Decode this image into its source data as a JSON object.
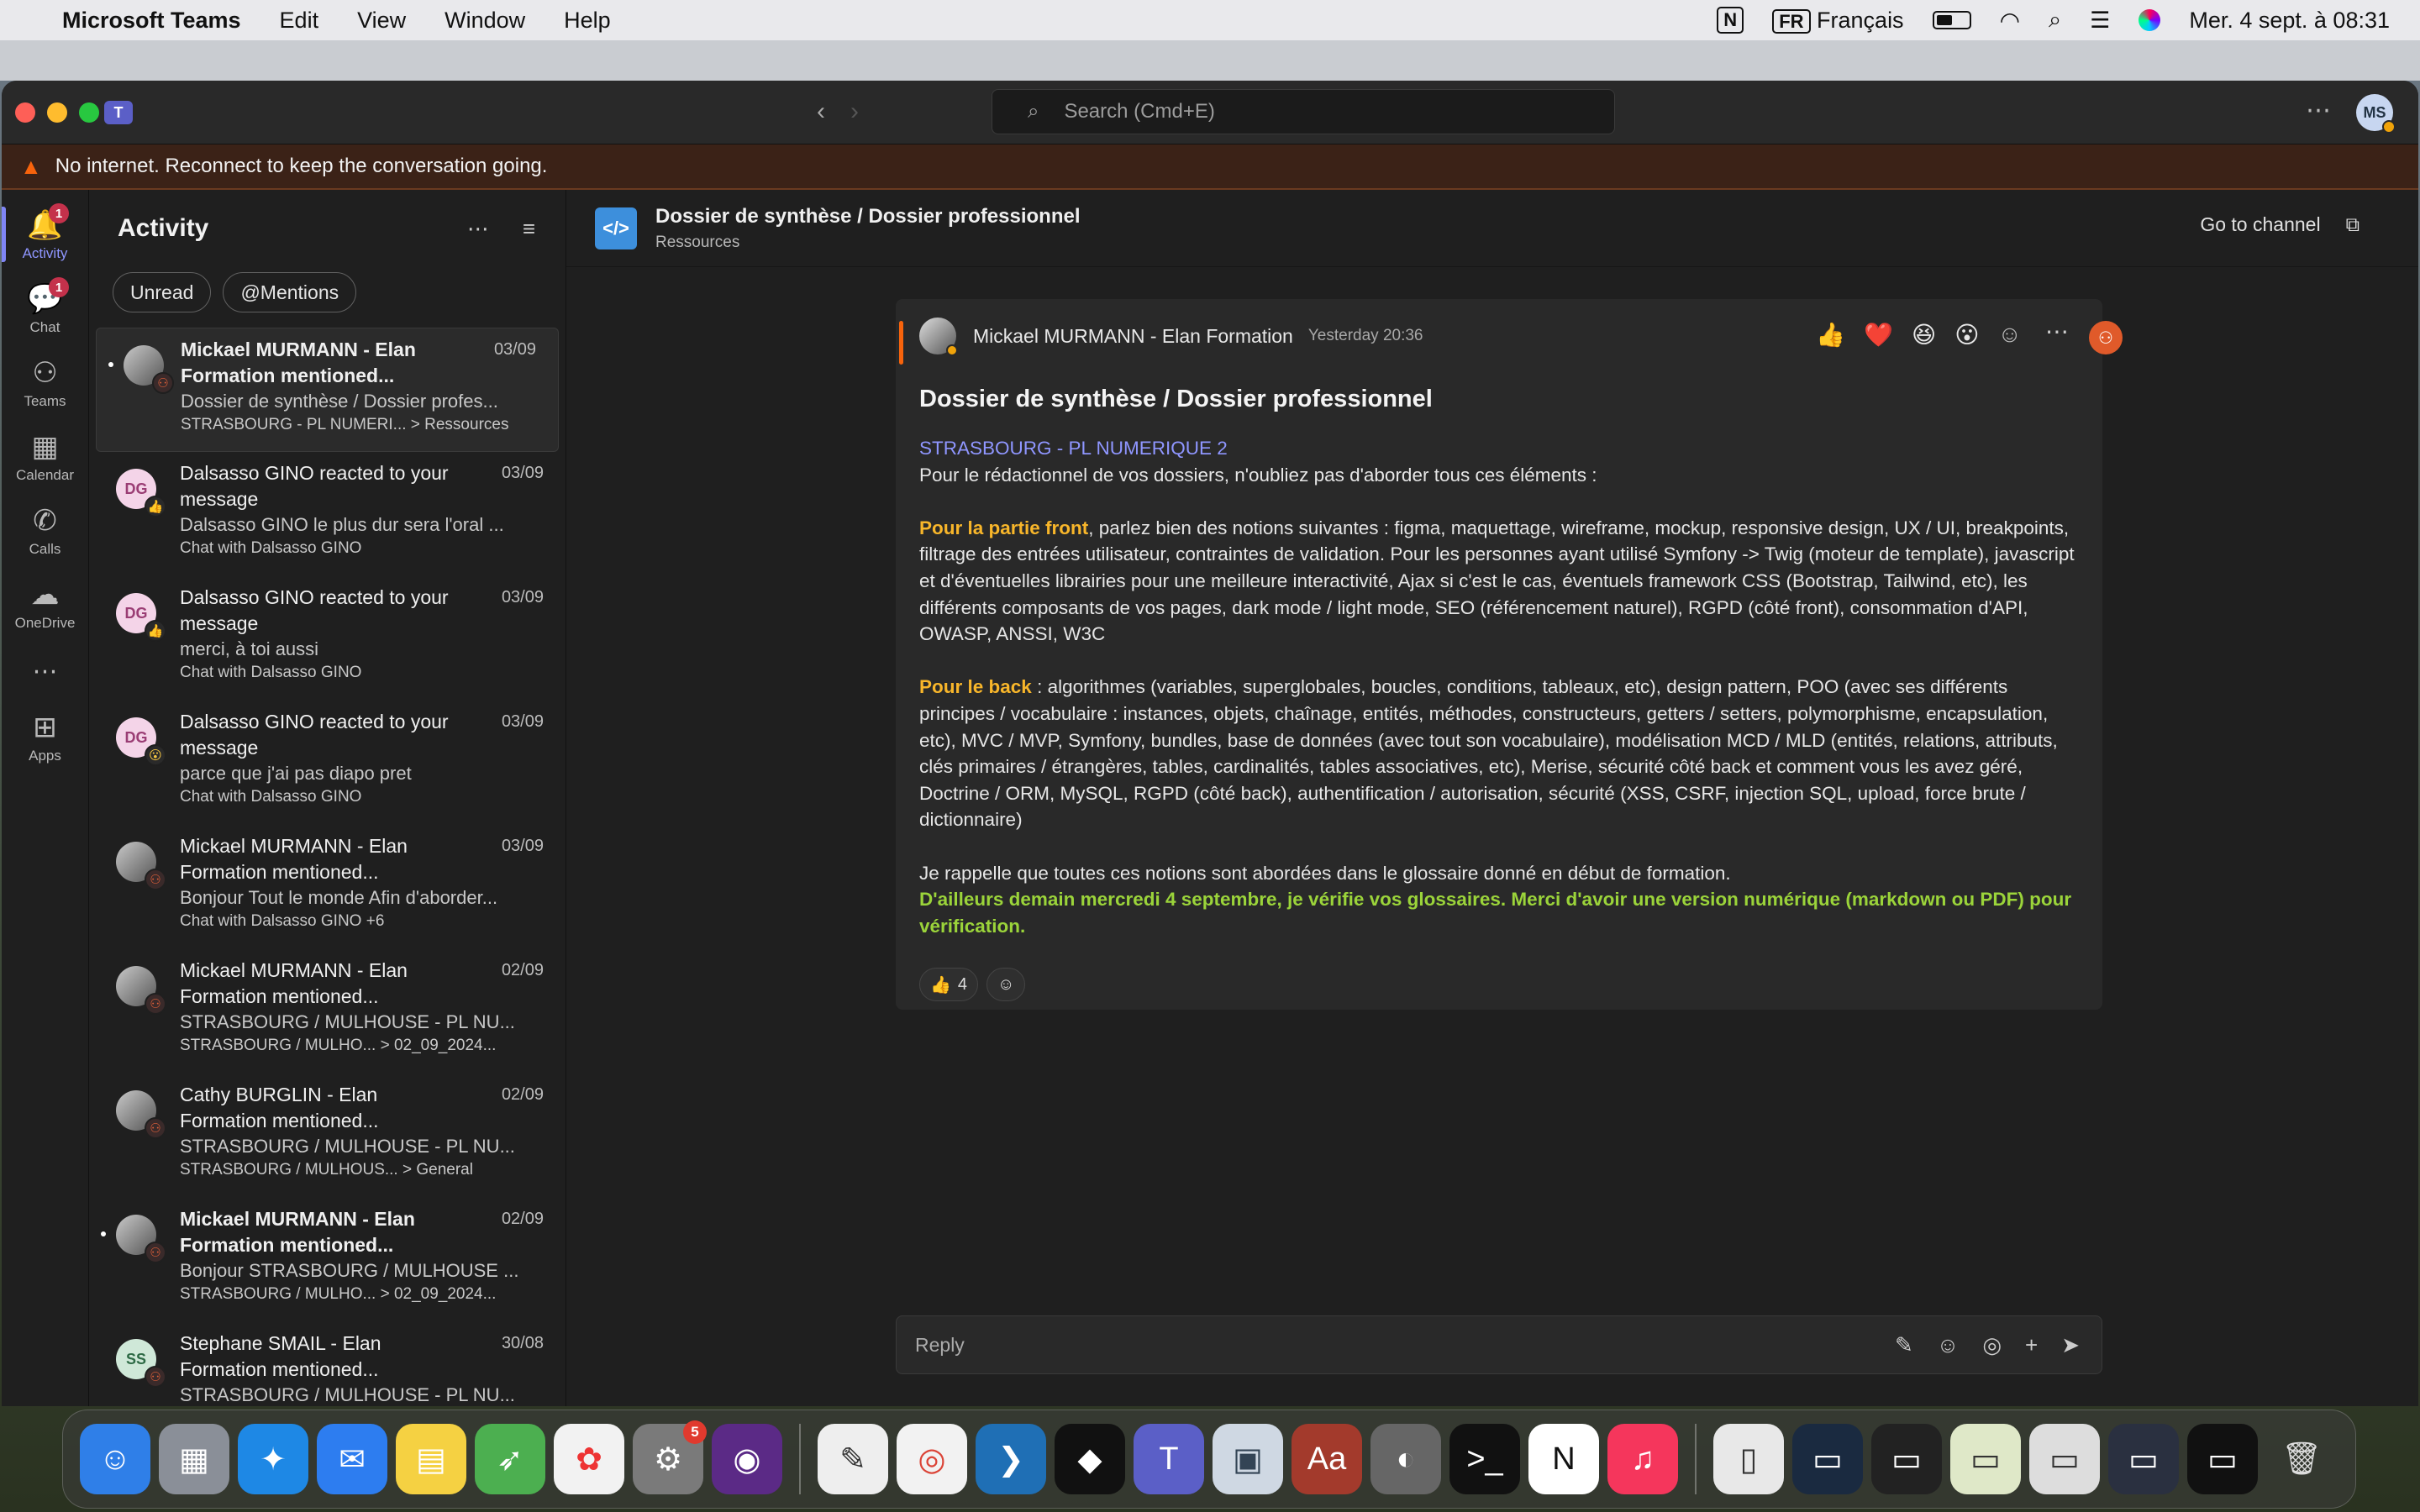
{
  "menubar": {
    "app_name": "Microsoft Teams",
    "menus": [
      "Edit",
      "View",
      "Window",
      "Help"
    ],
    "notion_glyph": "N",
    "input_code": "FR",
    "input_label": "Français",
    "datetime": "Mer. 4 sept. à 08:31"
  },
  "titlebar": {
    "search_placeholder": "Search (Cmd+E)",
    "me_initials": "MS"
  },
  "banner": {
    "text": "No internet. Reconnect to keep the conversation going."
  },
  "rail": {
    "items": [
      {
        "label": "Activity",
        "icon": "bell-icon",
        "badge": "1"
      },
      {
        "label": "Chat",
        "icon": "chat-icon",
        "badge": "1"
      },
      {
        "label": "Teams",
        "icon": "teams-icon"
      },
      {
        "label": "Calendar",
        "icon": "calendar-icon"
      },
      {
        "label": "Calls",
        "icon": "phone-icon"
      },
      {
        "label": "OneDrive",
        "icon": "cloud-icon"
      },
      {
        "label": "Apps",
        "icon": "plus-icon"
      }
    ]
  },
  "activity": {
    "title": "Activity",
    "filters": [
      "Unread",
      "@Mentions"
    ],
    "items": [
      {
        "title": "Mickael MURMANN - Elan Formation mentioned...",
        "date": "03/09",
        "preview": "Dossier de synthèse / Dossier profes...",
        "context": "STRASBOURG - PL NUMERI... > Ressources",
        "avatar": "photo",
        "badge": "team",
        "bold": true,
        "unread": true
      },
      {
        "title": "Dalsasso GINO reacted to your message",
        "date": "03/09",
        "preview": "Dalsasso GINO le plus dur sera l'oral ...",
        "context": "Chat with Dalsasso GINO",
        "avatar": "DG",
        "badge": "like"
      },
      {
        "title": "Dalsasso GINO reacted to your message",
        "date": "03/09",
        "preview": "merci, à toi aussi",
        "context": "Chat with Dalsasso GINO",
        "avatar": "DG",
        "badge": "like"
      },
      {
        "title": "Dalsasso GINO reacted to your message",
        "date": "03/09",
        "preview": "parce que j'ai pas diapo pret",
        "context": "Chat with Dalsasso GINO",
        "avatar": "DG",
        "badge": "wow"
      },
      {
        "title": "Mickael MURMANN - Elan Formation mentioned...",
        "date": "03/09",
        "preview": "Bonjour Tout le monde Afin d'aborder...",
        "context": "Chat with Dalsasso GINO +6",
        "avatar": "photo",
        "badge": "group"
      },
      {
        "title": "Mickael MURMANN - Elan Formation mentioned...",
        "date": "02/09",
        "preview": "STRASBOURG / MULHOUSE - PL NU...",
        "context": "STRASBOURG / MULHO... > 02_09_2024...",
        "avatar": "photo",
        "badge": "team"
      },
      {
        "title": "Cathy BURGLIN - Elan Formation mentioned...",
        "date": "02/09",
        "preview": "STRASBOURG / MULHOUSE - PL NU...",
        "context": "STRASBOURG / MULHOUS... > General",
        "avatar": "photo",
        "badge": "team"
      },
      {
        "title": "Mickael MURMANN - Elan Formation mentioned...",
        "date": "02/09",
        "preview": "Bonjour STRASBOURG / MULHOUSE ...",
        "context": "STRASBOURG / MULHO... > 02_09_2024...",
        "avatar": "photo",
        "badge": "team",
        "bold": true,
        "unread": true
      },
      {
        "title": "Stephane SMAIL - Elan Formation mentioned...",
        "date": "30/08",
        "preview": "STRASBOURG / MULHOUSE - PL NU...",
        "context": "",
        "avatar": "SS",
        "badge": "team"
      }
    ]
  },
  "channel": {
    "icon_text": "</>",
    "title": "Dossier de synthèse / Dossier professionnel",
    "subtitle": "Ressources",
    "goto_label": "Go to channel"
  },
  "post": {
    "author": "Mickael MURMANN - Elan Formation",
    "time": "Yesterday 20:36",
    "subject": "Dossier de synthèse / Dossier professionnel",
    "mention": "STRASBOURG - PL NUMERIQUE 2",
    "intro": "Pour le rédactionnel de vos dossiers, n'oubliez pas d'aborder tous ces éléments :",
    "front_label": "Pour la partie front",
    "front_text": ", parlez bien des notions suivantes : figma, maquettage, wireframe, mockup, responsive design, UX / UI, breakpoints, filtrage des entrées utilisateur, contraintes de validation. Pour les personnes ayant utilisé Symfony -> Twig (moteur de template), javascript et d'éventuelles librairies pour une meilleure interactivité, Ajax si c'est le cas, éventuels framework CSS (Bootstrap, Tailwind, etc), les différents composants de vos pages, dark mode / light mode, SEO (référencement naturel), RGPD (côté front), consommation d'API, OWASP, ANSSI, W3C",
    "back_label": "Pour le back",
    "back_text": " : algorithmes (variables, superglobales, boucles, conditions, tableaux, etc), design pattern, POO (avec ses différents principes / vocabulaire : instances, objets, chaînage, entités, méthodes, constructeurs, getters / setters, polymorphisme, encapsulation, etc), MVC / MVP, Symfony, bundles, base de données (avec tout son vocabulaire), modélisation MCD / MLD (entités, relations, attributs, clés primaires / étrangères, tables, cardinalités, tables associatives, etc), Merise, sécurité côté back et comment vous les avez géré, Doctrine / ORM, MySQL, RGPD (côté back), authentification / autorisation, sécurité (XSS, CSRF, injection SQL, upload, force brute / dictionnaire)",
    "reminder": "Je rappelle que toutes ces notions sont abordées dans le glossaire donné en début de formation.",
    "highlight": "D'ailleurs demain mercredi 4 septembre, je vérifie vos glossaires. Merci d'avoir une version numérique (markdown ou PDF) pour vérification.",
    "like_count": "4"
  },
  "reply": {
    "placeholder": "Reply"
  },
  "dock": {
    "settings_badge": "5"
  }
}
